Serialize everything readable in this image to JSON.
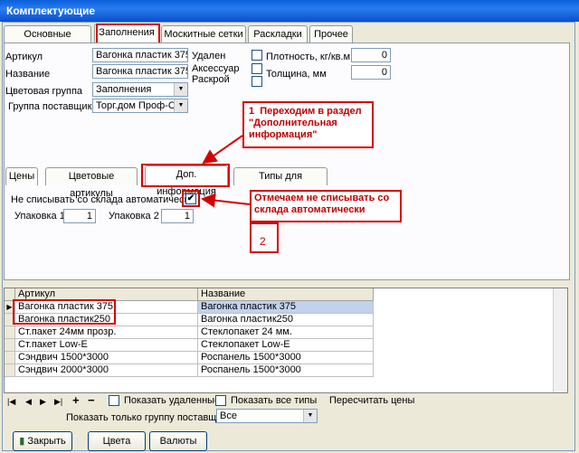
{
  "window": {
    "title": "Комплектующие"
  },
  "main_tabs": [
    "Основные профили",
    "Заполнения",
    "Москитные сетки",
    "Раскладки",
    "Прочее"
  ],
  "form": {
    "article_label": "Артикул",
    "article_value": "Вагонка пластик 375",
    "name_label": "Название",
    "name_value": "Вагонка пластик 375",
    "color_group_label": "Цветовая группа",
    "color_group_value": "Заполнения",
    "supplier_group_label": "Группа поставщика",
    "supplier_group_value": "Торг.дом Проф-Сити",
    "deleted_label": "Удален",
    "accessory_label": "Аксессуар",
    "cutting_label": "Раскрой",
    "density_label": "Плотность, кг/кв.м.",
    "density_value": "0",
    "thickness_label": "Толщина, мм",
    "thickness_value": "0"
  },
  "sub_tabs": [
    "Цены",
    "Цветовые артикулы",
    "Доп. информация",
    "Типы для распечатки"
  ],
  "extra": {
    "no_writeoff_label": "Не списывать со склада автоматически",
    "no_writeoff_checked": true,
    "pack1_label": "Упаковка 1",
    "pack1_value": "1",
    "pack2_label": "Упаковка 2",
    "pack2_value": "1"
  },
  "annotations": {
    "note1": "1  Переходим в раздел\n\"Дополнительная\nинформация\"",
    "note2": "Отмечаем не списывать со\nсклада автоматически",
    "step2": "2"
  },
  "grid": {
    "columns": [
      "Артикул",
      "Название"
    ],
    "rows": [
      [
        "Вагонка пластик 375",
        "Вагонка пластик 375"
      ],
      [
        "Вагонка пластик250",
        "Вагонка пластик250"
      ],
      [
        "Ст.пакет 24мм прозр.",
        "Стеклопакет 24 мм."
      ],
      [
        "Ст.пакет Low-E",
        "Стеклопакет Low-E"
      ],
      [
        "Сэндвич 1500*3000",
        "Роспанель 1500*3000"
      ],
      [
        "Сэндвич 2000*3000",
        "Роспанель 1500*3000"
      ]
    ]
  },
  "footer": {
    "show_deleted": "Показать удаленные",
    "show_all_types": "Показать все типы",
    "recalc": "Пересчитать цены",
    "supplier_filter_label": "Показать только группу поставщика",
    "supplier_filter_value": "Все",
    "close": "Закрыть",
    "colors": "Цвета",
    "currencies": "Валюты"
  }
}
